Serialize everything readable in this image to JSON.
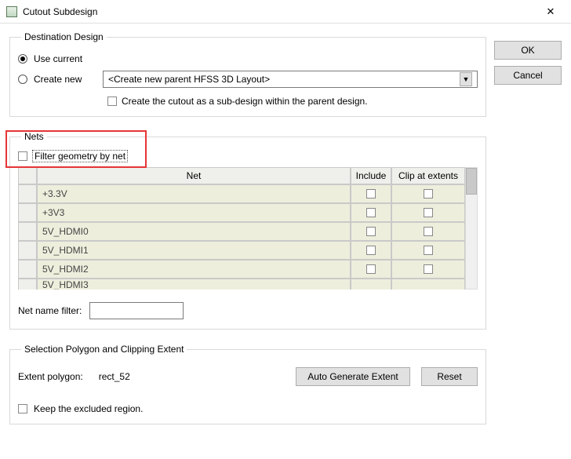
{
  "window": {
    "title": "Cutout Subdesign"
  },
  "buttons": {
    "ok": "OK",
    "cancel": "Cancel"
  },
  "dest": {
    "legend": "Destination Design",
    "use_current": "Use current",
    "create_new": "Create new",
    "combo_value": "<Create new parent HFSS 3D Layout>",
    "sub_label": "Create the cutout as a sub-design within the parent design."
  },
  "nets": {
    "legend": "Nets",
    "filter_label": "Filter geometry by net",
    "headers": {
      "net": "Net",
      "include": "Include",
      "clip": "Clip at extents"
    },
    "rows": [
      {
        "name": "+3.3V"
      },
      {
        "name": "+3V3"
      },
      {
        "name": "5V_HDMI0"
      },
      {
        "name": "5V_HDMI1"
      },
      {
        "name": "5V_HDMI2"
      },
      {
        "name": "5V_HDMI3"
      }
    ],
    "netname_label": "Net name filter:"
  },
  "sp": {
    "legend": "Selection Polygon and Clipping Extent",
    "extent_label": "Extent polygon:",
    "extent_value": "rect_52",
    "auto": "Auto Generate Extent",
    "reset": "Reset",
    "keep": "Keep the excluded region."
  }
}
